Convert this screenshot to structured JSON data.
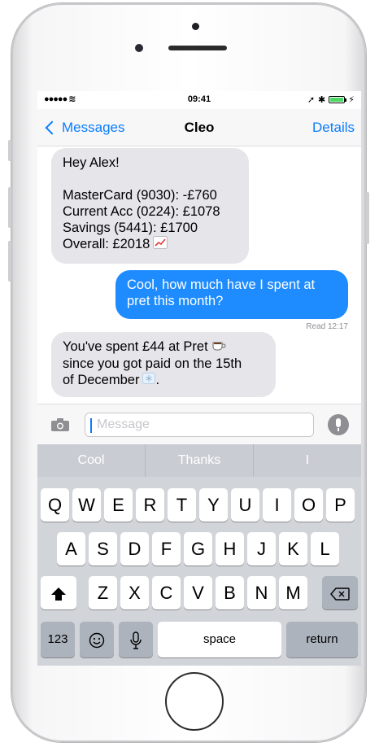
{
  "statusbar": {
    "signal": "●●●●● ≋",
    "time": "09:41"
  },
  "navbar": {
    "back_label": "Messages",
    "title": "Cleo",
    "details_label": "Details"
  },
  "messages": [
    {
      "direction": "incoming",
      "lines": [
        "Hey Alex!",
        "",
        "MasterCard (9030): -£760",
        "Current Acc (0224): £1078",
        "Savings (5441): £1700",
        "Overall: £2018"
      ],
      "emoji": "chart-increasing"
    },
    {
      "direction": "outgoing",
      "lines": [
        "Cool, how much have I spent at",
        "pret this month?"
      ]
    },
    {
      "direction": "incoming",
      "lines": [
        "You've spent £44 at Pret",
        "since you got paid on the 15th",
        "of December"
      ],
      "emoji": [
        "coffee",
        "snowflake"
      ]
    }
  ],
  "read_receipt": "Read 12:17",
  "input": {
    "placeholder": "Message"
  },
  "suggestions": [
    "Cool",
    "Thanks",
    "I"
  ],
  "keyboard": {
    "row1": [
      "Q",
      "W",
      "E",
      "R",
      "T",
      "Y",
      "U",
      "I",
      "O",
      "P"
    ],
    "row2": [
      "A",
      "S",
      "D",
      "F",
      "G",
      "H",
      "J",
      "K",
      "L"
    ],
    "row3": [
      "Z",
      "X",
      "C",
      "V",
      "B",
      "N",
      "M"
    ],
    "numbers_key": "123",
    "space_key": "space",
    "return_key": "return"
  },
  "colors": {
    "accent": "#0a7cff",
    "outgoing_bubble": "#1e8cff",
    "incoming_bubble": "#e5e5ea"
  }
}
